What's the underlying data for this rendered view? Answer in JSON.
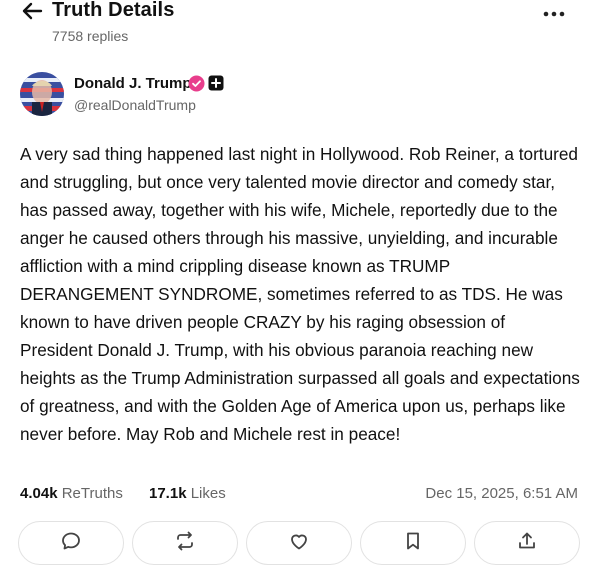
{
  "header": {
    "title": "Truth Details",
    "replies": "7758 replies"
  },
  "author": {
    "name": "Donald J. Trump",
    "handle": "@realDonaldTrump",
    "verified_color": "#e83e8c"
  },
  "post": {
    "text": "A very sad thing happened last night in Hollywood. Rob Reiner, a tortured and struggling, but once very talented movie director and comedy star, has passed away, together with his wife, Michele, reportedly due to the anger he caused others through his massive, unyielding, and incurable affliction with a mind crippling disease known as TRUMP DERANGEMENT SYNDROME, sometimes referred to as TDS. He was known to have driven people CRAZY by his raging obsession of President Donald J. Trump, with his obvious paranoia reaching new heights as the Trump Administration surpassed all goals and expectations of greatness, and with the Golden Age of America upon us, perhaps like never before. May Rob and Michele rest in peace!"
  },
  "stats": {
    "retruths_count": "4.04k",
    "retruths_label": "ReTruths",
    "likes_count": "17.1k",
    "likes_label": "Likes",
    "timestamp": "Dec 15, 2025, 6:51 AM"
  },
  "actions": [
    {
      "icon": "comment-icon"
    },
    {
      "icon": "retruth-icon"
    },
    {
      "icon": "heart-icon"
    },
    {
      "icon": "bookmark-icon"
    },
    {
      "icon": "share-icon"
    }
  ]
}
